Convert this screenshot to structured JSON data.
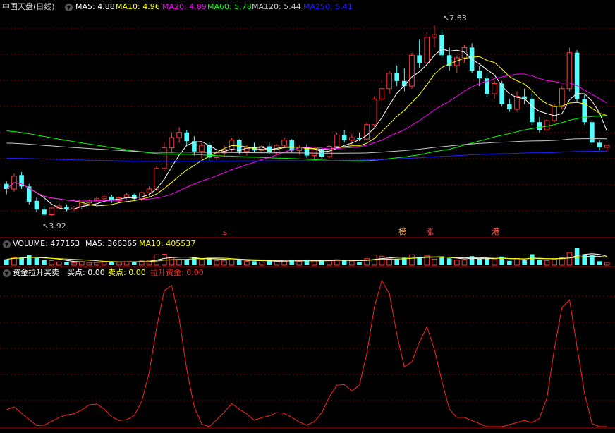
{
  "colors": {
    "up": "#ff3b3b",
    "down": "#54ffff",
    "ma5": "#ffffff",
    "ma10": "#ffff00",
    "ma20": "#ff00ff",
    "ma60": "#00ff00",
    "ma120": "#c8c8c8",
    "ma250": "#2020ff",
    "vol_ma5": "#ffffff",
    "vol_ma10": "#ffff00",
    "fund_line": "#ff2020",
    "buy": "#ffffff",
    "sell": "#ffff00",
    "lift": "#ff2020",
    "grid": "#7a0000"
  },
  "header": {
    "title": "中国天盘(日线)",
    "ma_labels": [
      {
        "text": "MA5: 4.88",
        "color": "#ffffff"
      },
      {
        "text": "MA10: 4.96",
        "color": "#ffff00"
      },
      {
        "text": "MA20: 4.89",
        "color": "#ff00ff"
      },
      {
        "text": "MA60: 5.78",
        "color": "#00ff00"
      },
      {
        "text": "MA120: 5.44",
        "color": "#c8c8c8"
      },
      {
        "text": "MA250: 5.41",
        "color": "#2020ff"
      }
    ]
  },
  "volume_header": {
    "title": "VOLUME: 477153",
    "ma5": "MA5: 366365",
    "ma10": "MA10: 405537"
  },
  "indicator_header": {
    "title": "资金拉升买卖",
    "buy": "买点: 0.00",
    "sell": "卖点: 0.00",
    "lift": "拉升资金: 0.00"
  },
  "markers": {
    "high_label": "7.63",
    "low_label": "3.92",
    "event_s": "s",
    "event_bang": "榜",
    "event_zhang": "涨",
    "event_gang": "港"
  },
  "chart_data": {
    "type": "candlestick",
    "price_range": [
      3.6,
      7.85
    ],
    "candles": [
      [
        4.55,
        4.6,
        4.35,
        4.45
      ],
      [
        4.45,
        4.75,
        4.4,
        4.7
      ],
      [
        4.72,
        4.78,
        4.45,
        4.5
      ],
      [
        4.5,
        4.55,
        4.15,
        4.2
      ],
      [
        4.22,
        4.28,
        4.0,
        4.05
      ],
      [
        4.05,
        4.12,
        3.93,
        3.95
      ],
      [
        3.95,
        4.1,
        3.92,
        4.08
      ],
      [
        4.08,
        4.18,
        4.05,
        4.12
      ],
      [
        4.1,
        4.15,
        4.02,
        4.06
      ],
      [
        4.06,
        4.12,
        4.02,
        4.1
      ],
      [
        4.1,
        4.2,
        4.06,
        4.18
      ],
      [
        4.18,
        4.25,
        4.14,
        4.22
      ],
      [
        4.22,
        4.3,
        4.18,
        4.26
      ],
      [
        4.26,
        4.35,
        4.2,
        4.3
      ],
      [
        4.3,
        4.34,
        4.18,
        4.22
      ],
      [
        4.22,
        4.3,
        4.18,
        4.28
      ],
      [
        4.28,
        4.38,
        4.24,
        4.34
      ],
      [
        4.34,
        4.36,
        4.22,
        4.26
      ],
      [
        4.26,
        4.4,
        4.22,
        4.38
      ],
      [
        4.38,
        4.5,
        4.3,
        4.45
      ],
      [
        4.45,
        4.9,
        4.42,
        4.85
      ],
      [
        4.85,
        5.35,
        4.8,
        5.25
      ],
      [
        5.25,
        5.55,
        5.15,
        5.45
      ],
      [
        5.45,
        5.65,
        5.35,
        5.55
      ],
      [
        5.55,
        5.6,
        5.3,
        5.38
      ],
      [
        5.38,
        5.48,
        5.1,
        5.18
      ],
      [
        5.18,
        5.35,
        5.05,
        5.3
      ],
      [
        5.3,
        5.36,
        5.0,
        5.06
      ],
      [
        5.06,
        5.2,
        4.98,
        5.15
      ],
      [
        5.15,
        5.3,
        5.08,
        5.22
      ],
      [
        5.22,
        5.45,
        5.18,
        5.4
      ],
      [
        5.4,
        5.42,
        5.12,
        5.18
      ],
      [
        5.18,
        5.3,
        5.1,
        5.26
      ],
      [
        5.26,
        5.35,
        5.15,
        5.2
      ],
      [
        5.2,
        5.3,
        5.14,
        5.28
      ],
      [
        5.28,
        5.36,
        5.12,
        5.16
      ],
      [
        5.16,
        5.32,
        5.12,
        5.3
      ],
      [
        5.3,
        5.45,
        5.24,
        5.4
      ],
      [
        5.4,
        5.42,
        5.15,
        5.2
      ],
      [
        5.2,
        5.3,
        5.12,
        5.26
      ],
      [
        5.26,
        5.32,
        5.05,
        5.1
      ],
      [
        5.1,
        5.25,
        5.02,
        5.22
      ],
      [
        5.22,
        5.26,
        5.04,
        5.08
      ],
      [
        5.08,
        5.3,
        5.05,
        5.28
      ],
      [
        5.28,
        5.55,
        5.26,
        5.5
      ],
      [
        5.5,
        5.6,
        5.35,
        5.4
      ],
      [
        5.4,
        5.52,
        5.3,
        5.45
      ],
      [
        5.45,
        5.55,
        5.38,
        5.42
      ],
      [
        5.42,
        5.75,
        5.4,
        5.7
      ],
      [
        5.7,
        6.25,
        5.65,
        6.2
      ],
      [
        6.2,
        6.55,
        6.0,
        6.4
      ],
      [
        6.4,
        6.75,
        6.3,
        6.7
      ],
      [
        6.7,
        6.85,
        6.45,
        6.55
      ],
      [
        6.55,
        6.8,
        6.35,
        6.45
      ],
      [
        6.45,
        7.1,
        6.4,
        7.05
      ],
      [
        7.05,
        7.35,
        6.8,
        6.9
      ],
      [
        6.9,
        7.5,
        6.85,
        7.4
      ],
      [
        7.4,
        7.63,
        7.2,
        7.45
      ],
      [
        7.45,
        7.55,
        7.0,
        7.05
      ],
      [
        7.05,
        7.2,
        6.75,
        6.85
      ],
      [
        6.85,
        7.05,
        6.7,
        7.0
      ],
      [
        7.0,
        7.25,
        6.9,
        7.2
      ],
      [
        7.2,
        7.28,
        6.7,
        6.75
      ],
      [
        6.75,
        6.85,
        6.45,
        6.6
      ],
      [
        6.6,
        6.7,
        6.25,
        6.3
      ],
      [
        6.3,
        6.55,
        6.2,
        6.5
      ],
      [
        6.5,
        6.55,
        6.05,
        6.1
      ],
      [
        6.1,
        6.2,
        5.95,
        6.0
      ],
      [
        6.0,
        6.35,
        5.95,
        6.25
      ],
      [
        6.25,
        6.4,
        6.1,
        6.2
      ],
      [
        6.2,
        6.3,
        5.7,
        5.75
      ],
      [
        5.75,
        5.85,
        5.55,
        5.6
      ],
      [
        5.6,
        5.8,
        5.55,
        5.78
      ],
      [
        5.78,
        6.1,
        5.75,
        6.05
      ],
      [
        6.05,
        6.45,
        6.0,
        6.4
      ],
      [
        6.4,
        7.2,
        6.35,
        7.1
      ],
      [
        7.1,
        7.15,
        6.15,
        6.2
      ],
      [
        6.2,
        6.28,
        5.7,
        5.75
      ],
      [
        5.75,
        5.8,
        5.3,
        5.35
      ],
      [
        5.35,
        5.4,
        5.2,
        5.26
      ],
      [
        5.26,
        5.32,
        5.18,
        5.3
      ]
    ],
    "volume_series": [
      {
        "name": "VOLUME",
        "value": 477153
      },
      {
        "name": "MA5",
        "value": 366365
      },
      {
        "name": "MA10",
        "value": 405537
      }
    ]
  }
}
